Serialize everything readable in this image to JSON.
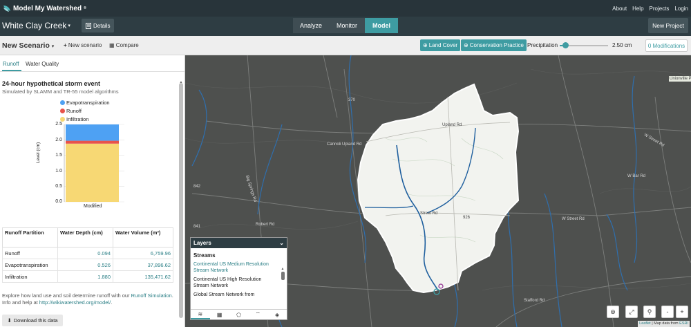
{
  "app": {
    "name": "Model My Watershed",
    "trademark": "®"
  },
  "top_links": [
    "About",
    "Help",
    "Projects",
    "Login"
  ],
  "project": {
    "name": "White Clay Creek",
    "details_label": "Details"
  },
  "main_tabs": [
    {
      "label": "Analyze",
      "active": false
    },
    {
      "label": "Monitor",
      "active": false
    },
    {
      "label": "Model",
      "active": true
    }
  ],
  "new_project_label": "New Project",
  "scenario_bar": {
    "current": "New Scenario",
    "new_label": "New scenario",
    "compare_label": "Compare",
    "land_cover_label": "Land Cover",
    "conservation_label": "Conservation Practice",
    "precip_label": "Precipitation",
    "precip_value": "2.50 cm",
    "precip_fraction": 0.12,
    "modifications_label": "0 Modifications"
  },
  "panel_tabs": [
    {
      "label": "Runoff",
      "active": true
    },
    {
      "label": "Water Quality",
      "active": false
    }
  ],
  "storm": {
    "title": "24-hour hypothetical storm event",
    "subtitle": "Simulated by SLAMM and TR-55 model algorithms"
  },
  "colors": {
    "evapotranspiration": "#4ea1f3",
    "runoff": "#e8534b",
    "infiltration": "#f7d874",
    "accent": "#3e9ca2"
  },
  "chart_data": {
    "type": "bar",
    "stacked": true,
    "categories": [
      "Modified"
    ],
    "series": [
      {
        "name": "Infiltration",
        "values": [
          1.88
        ],
        "color": "#f7d874"
      },
      {
        "name": "Runoff",
        "values": [
          0.094
        ],
        "color": "#e8534b"
      },
      {
        "name": "Evapotranspiration",
        "values": [
          0.526
        ],
        "color": "#4ea1f3"
      }
    ],
    "legend_order": [
      "Evapotranspiration",
      "Runoff",
      "Infiltration"
    ],
    "ylabel": "Level (cm)",
    "ylim": [
      0,
      2.5
    ],
    "yticks": [
      "2.5",
      "2.0",
      "1.5",
      "1.0",
      "0.5",
      "0.0"
    ],
    "grid": true,
    "legend_position": "top"
  },
  "table": {
    "headers": [
      "Runoff Partition",
      "Water Depth (cm)",
      "Water Volume (m³)"
    ],
    "rows": [
      [
        "Runoff",
        "0.094",
        "6,759.96"
      ],
      [
        "Evapotranspiration",
        "0.526",
        "37,896.62"
      ],
      [
        "Infiltration",
        "1.880",
        "135,471.62"
      ]
    ]
  },
  "explore": {
    "prefix": "Explore how land use and soil determine runoff with our ",
    "link1": "Runoff Simulation",
    "middle": ". Info and help at ",
    "link2": "http://wikiwatershed.org/model/",
    "suffix": "."
  },
  "download_label": "Download this data",
  "map_labels": [
    "Upland Rd",
    "Cannoli Upland Rd",
    "Big Springs Rd",
    "W Street Rd",
    "Street Rd",
    "Robert Rd",
    "Stafford Rd",
    "926",
    "842",
    "841",
    "370",
    "W Street Rd",
    "W Bar Rd",
    "Unionville Park"
  ],
  "layers": {
    "title": "Layers",
    "section": "Streams",
    "options": [
      {
        "label": "Continental US Medium Resolution Stream Network",
        "selected": true
      },
      {
        "label": "Continental US High Resolution Stream Network",
        "selected": false
      },
      {
        "label": "Global Stream Network from",
        "selected": false
      }
    ]
  },
  "map_controls": [
    "locate-icon",
    "fullscreen-icon",
    "pin-icon",
    "zoom-out",
    "zoom-in"
  ],
  "zoom_labels": {
    "minus": "-",
    "plus": "+"
  },
  "attribution": {
    "leaflet": "Leaflet",
    "sep": " | Map data from ",
    "esri": "ESRI"
  }
}
